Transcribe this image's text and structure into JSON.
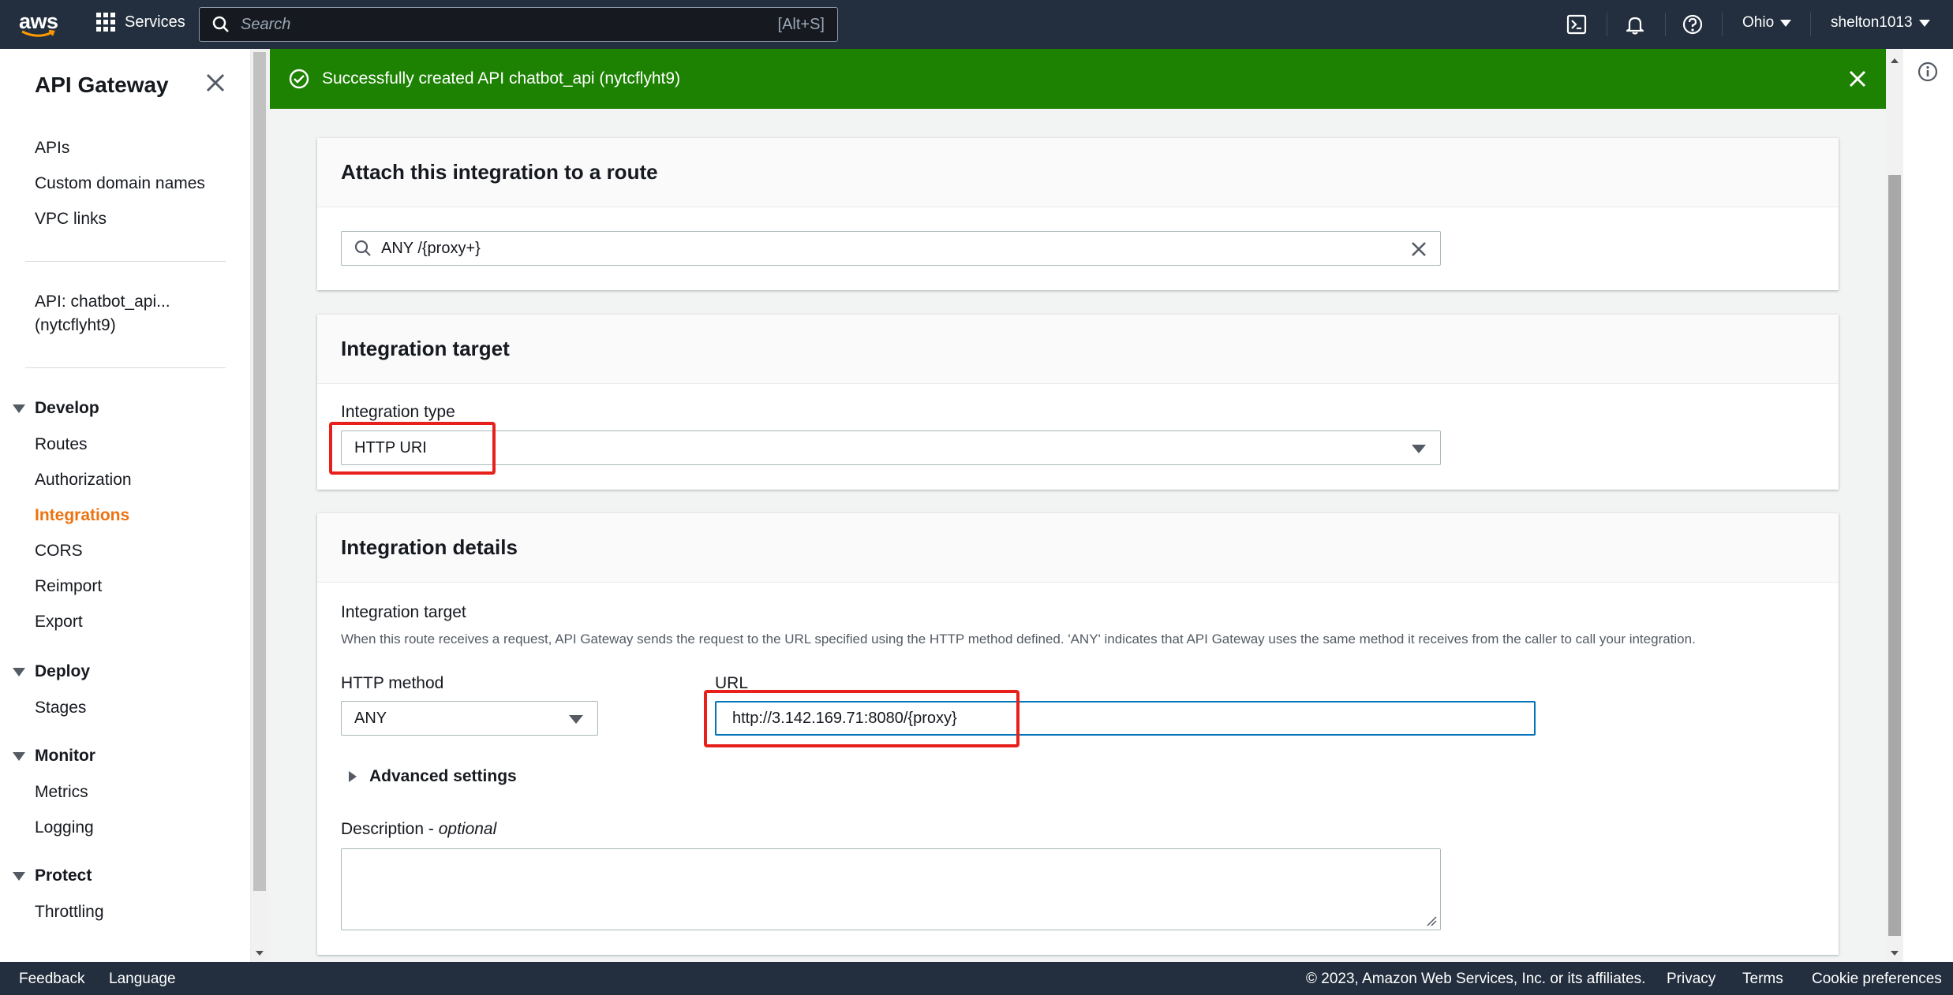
{
  "topnav": {
    "logo": "aws",
    "services": "Services",
    "search_placeholder": "Search",
    "search_shortcut": "[Alt+S]",
    "region": "Ohio",
    "account": "shelton1013",
    "icons": [
      "cloudshell-icon",
      "bell-icon",
      "help-icon"
    ]
  },
  "sidebar": {
    "title": "API Gateway",
    "top_links": [
      "APIs",
      "Custom domain names",
      "VPC links"
    ],
    "api_name_line1": "API: chatbot_api...",
    "api_name_line2": "(nytcflyht9)",
    "sections": [
      {
        "title": "Develop",
        "items": [
          "Routes",
          "Authorization",
          "Integrations",
          "CORS",
          "Reimport",
          "Export"
        ]
      },
      {
        "title": "Deploy",
        "items": [
          "Stages"
        ]
      },
      {
        "title": "Monitor",
        "items": [
          "Metrics",
          "Logging"
        ]
      },
      {
        "title": "Protect",
        "items": [
          "Throttling"
        ]
      }
    ],
    "active_item": "Integrations"
  },
  "flash": {
    "message": "Successfully created API chatbot_api (nytcflyht9)",
    "color": "#1d8102"
  },
  "attach_card": {
    "title": "Attach this integration to a route",
    "route_value": "ANY /{proxy+}"
  },
  "target_card": {
    "title": "Integration target",
    "type_label": "Integration type",
    "type_value": "HTTP URI"
  },
  "details_card": {
    "title": "Integration details",
    "target_label": "Integration target",
    "target_help": "When this route receives a request, API Gateway sends the request to the URL specified using the HTTP method defined. 'ANY' indicates that API Gateway uses the same method it receives from the caller to call your integration.",
    "method_label": "HTTP method",
    "method_value": "ANY",
    "url_label": "URL",
    "url_value": "http://3.142.169.71:8080/{proxy}",
    "advanced_label": "Advanced settings",
    "description_label": "Description",
    "description_optional": "optional",
    "description_value": ""
  },
  "footer": {
    "feedback": "Feedback",
    "language": "Language",
    "copyright": "© 2023, Amazon Web Services, Inc. or its affiliates.",
    "privacy": "Privacy",
    "terms": "Terms",
    "cookie": "Cookie preferences"
  },
  "colors": {
    "nav_bg": "#232f3e",
    "accent_orange": "#ec7211",
    "highlight_red": "#e8201b",
    "url_focus": "#0073bb"
  }
}
